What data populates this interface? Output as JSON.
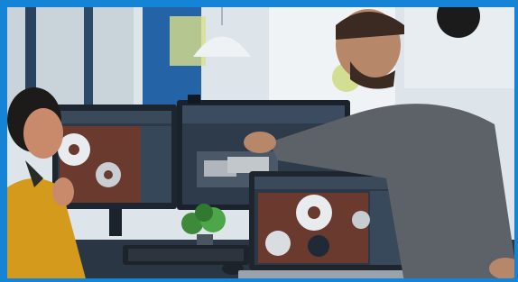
{
  "scene": {
    "subject": "photo",
    "colors": {
      "frame_border": "#1583d6",
      "office_wall": "#d9e2e8",
      "window_blue": "#2463a6",
      "woman_sweater": "#d49a1b",
      "man_shirt": "#5d6268",
      "desk": "#2a3644",
      "monitor_ui": "#2d3947",
      "cad_part_red": "#6b3a2e",
      "cad_part_white": "#e9ecef"
    },
    "icons": [
      "monitor-icon",
      "laptop-icon",
      "keyboard-icon",
      "mouse-icon",
      "plant-icon",
      "lamp-icon"
    ]
  }
}
